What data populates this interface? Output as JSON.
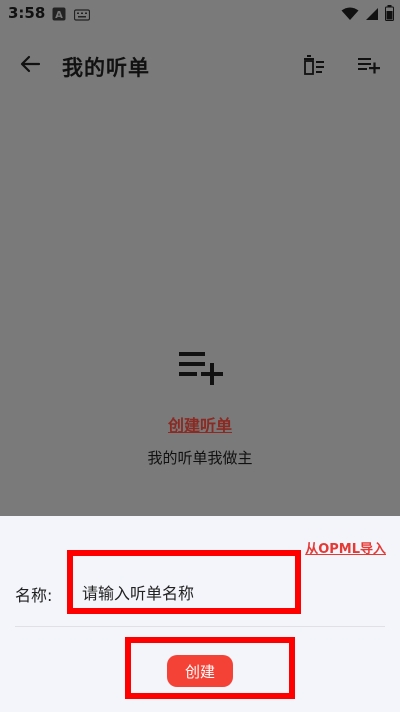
{
  "status_bar": {
    "time": "3:58",
    "icons": [
      "a-icon",
      "keyboard-icon",
      "wifi-icon",
      "signal-icon",
      "battery-icon"
    ]
  },
  "app_bar": {
    "title": "我的听单",
    "back_icon": "arrow-left-icon",
    "actions": [
      "clear-list-icon",
      "playlist-add-icon"
    ]
  },
  "empty_state": {
    "icon": "playlist-add-icon",
    "create_link": "创建听单",
    "subtitle": "我的听单我做主"
  },
  "sheet": {
    "import_link": "从OPML导入",
    "name_label": "名称:",
    "name_placeholder": "请输入听单名称",
    "create_button": "创建"
  },
  "colors": {
    "overlay": "#7a7a7a",
    "sheet_bg": "#f4f5fa",
    "accent": "#f44336",
    "link_dark_red": "#8a2a22",
    "highlight": "#ff0000"
  }
}
